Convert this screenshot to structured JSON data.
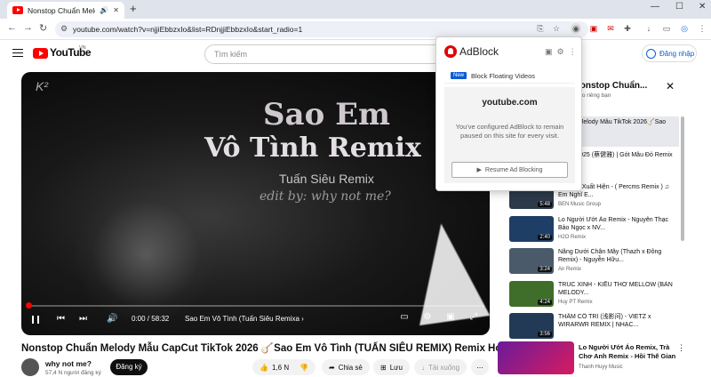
{
  "browser": {
    "tab_title": "Nonstop Chuẩn Melody Mẫ",
    "new_tab": "+",
    "url": "youtube.com/watch?v=njjiEbbzxIo&list=RDnjjiEbbzxIo&start_radio=1",
    "window_controls": [
      "—",
      "☐",
      "✕"
    ]
  },
  "header": {
    "logo": "YouTube",
    "region": "VN",
    "search_placeholder": "Tìm kiếm",
    "signin_label": "Đăng nhập"
  },
  "video": {
    "overlay_title_1": "Sao Em",
    "overlay_title_2": "Vô Tình Remix",
    "overlay_artist": "Tuấn Siêu Remix",
    "overlay_edit": "edit by: why not me?",
    "time": "0:00 / 58:32",
    "chapter": "Sao Em Vô Tình (Tuấn Siêu Remixa",
    "progress_fraction": 0.0
  },
  "info": {
    "title": "Nonstop Chuẩn Melody Mẫu CapCut TikTok 2026 🪕Sao Em Vô Tình (TUẤN SIÊU REMIX) Remix Hot TikTok 2026",
    "channel": "why not me?",
    "subscribers": "57,4 N người đăng ký",
    "subscribe_label": "Đăng ký",
    "likes": "1,6 N",
    "share_label": "Chia sẻ",
    "save_label": "Lưu",
    "download_label": "Tải xuống"
  },
  "playlist": {
    "header": "Mix - Nonstop Chuẩn...",
    "sub": "cho riêng bạn",
    "items": [
      {
        "title": "Chuẩn Melody Mẫu TikTok 2026🪕Sao E...",
        "channel": "e?",
        "duration": "",
        "color": "#5b4a6b"
      },
      {
        "title": "ng DJ 2025 (蔡健雅) | Gót Mâu Đỏ Remix -...",
        "channel": "",
        "duration": "",
        "color": "#3c2a34"
      },
      {
        "title": "Kiếp Đã Xuất Hiện - ( Percms Remix ) ♫ Em Nghĩ E...",
        "channel": "BEN Music Group",
        "duration": "5:48",
        "color": "#2d3a4a"
      },
      {
        "title": "Lo Người Ướt Áo Remix - Nguyễn Thạc Bảo Ngọc x NV...",
        "channel": "H2O Remix",
        "duration": "2:40",
        "color": "#1e3e66"
      },
      {
        "title": "Nâng Dưới Chân Mây (Thazh x Đông Remix) - Nguyễn Hữu...",
        "channel": "Air Remix",
        "duration": "3:24",
        "color": "#4a5a6a"
      },
      {
        "title": "TRÚC XINH - KIỀU THƠ MELLOW (BẢN MELODY...",
        "channel": "Huy PT Remix",
        "duration": "4:24",
        "color": "#3f6e2a"
      },
      {
        "title": "THÂM CỐ TRI (浅影问) - VIETZ x WIRARWR REMIX | NHẠC...",
        "channel": "",
        "duration": "3:56",
        "color": "#223a55"
      }
    ]
  },
  "recommended": {
    "title": "Lo Người Ướt Áo Remix, Trà Chơ Anh Remix - Hồi Thế Gian Ơi T...",
    "channel": "Thanh Huyy Music"
  },
  "adblock": {
    "name": "AdBlock",
    "new_badge": "New",
    "feature": "Block Floating Videos",
    "site": "youtube.com",
    "message": "You've configured AdBlock to remain paused on this site for every visit.",
    "resume_label": "Resume Ad Blocking"
  }
}
